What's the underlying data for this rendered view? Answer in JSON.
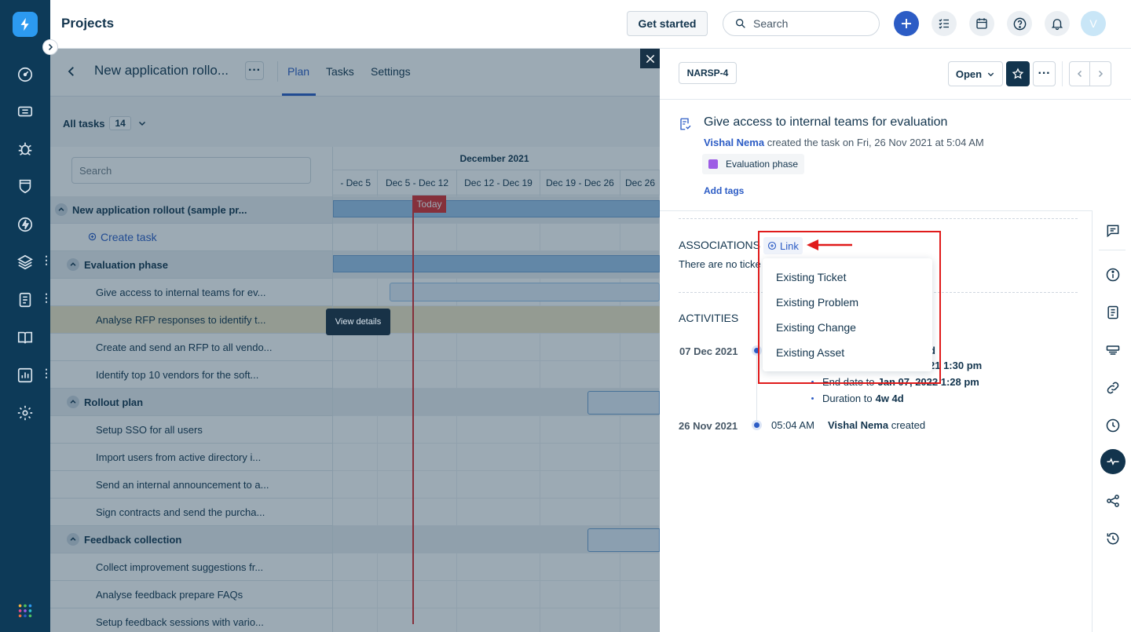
{
  "app": {
    "title": "Projects"
  },
  "header": {
    "get_started": "Get started",
    "search_placeholder": "Search",
    "avatar_initial": "V"
  },
  "project": {
    "name": "New application rollo...",
    "tabs": [
      "Plan",
      "Tasks",
      "Settings"
    ],
    "active_tab": "Plan",
    "all_tasks_label": "All tasks",
    "all_tasks_count": "14",
    "search_placeholder": "Search",
    "create_task": "Create task",
    "view_details": "View details",
    "rows": [
      {
        "text": "New application rollout (sample pr...",
        "kind": "root"
      },
      {
        "text": "Create task",
        "kind": "create"
      },
      {
        "text": "Evaluation phase",
        "kind": "group"
      },
      {
        "text": "Give access to internal teams for ev...",
        "kind": "task"
      },
      {
        "text": "Analyse RFP responses to identify t...",
        "kind": "task"
      },
      {
        "text": "Create and send an RFP to all vendo...",
        "kind": "task"
      },
      {
        "text": "Identify top 10 vendors for the soft...",
        "kind": "task"
      },
      {
        "text": "Rollout plan",
        "kind": "group"
      },
      {
        "text": "Setup SSO for all users",
        "kind": "task"
      },
      {
        "text": "Import users from active directory i...",
        "kind": "task"
      },
      {
        "text": "Send an internal announcement to a...",
        "kind": "task"
      },
      {
        "text": "Sign contracts and send the purcha...",
        "kind": "task"
      },
      {
        "text": "Feedback collection",
        "kind": "group"
      },
      {
        "text": "Collect improvement suggestions fr...",
        "kind": "task"
      },
      {
        "text": "Analyse feedback prepare FAQs",
        "kind": "task"
      },
      {
        "text": "Setup feedback sessions with vario...",
        "kind": "task"
      }
    ]
  },
  "gantt": {
    "month": "December 2021",
    "weeks": [
      "- Dec 5",
      "Dec 5 - Dec 12",
      "Dec 12 - Dec 19",
      "Dec 19 - Dec 26",
      "Dec 26"
    ],
    "today_label": "Today"
  },
  "task": {
    "id": "NARSP-4",
    "status": "Open",
    "title": "Give access to internal teams for evaluation",
    "creator": "Vishal Nema",
    "created_text": "created the task on Fri, 26 Nov 2021 at 5:04 AM",
    "phase_tag": "Evaluation phase",
    "add_tags": "Add tags"
  },
  "associations": {
    "heading": "ASSOCIATIONS",
    "link_label": "Link",
    "empty_text": "There are no ticke",
    "menu": [
      "Existing Ticket",
      "Existing Problem",
      "Existing Change",
      "Existing Asset"
    ]
  },
  "activities": {
    "heading": "ACTIVITIES",
    "entries": [
      {
        "date": "07 Dec 2021",
        "partial_top": "d",
        "partial_line": "21 1:30 pm",
        "bullets": [
          {
            "label": "End date to",
            "value": "Jan 07, 2022 1:28 pm"
          },
          {
            "label": "Duration to",
            "value": "4w 4d"
          }
        ]
      },
      {
        "date": "26 Nov 2021",
        "time": "05:04 AM",
        "actor": "Vishal Nema",
        "action": "created"
      }
    ]
  },
  "colors": {
    "rail": "#0d3a58",
    "accent": "#2c5cc5",
    "annotation": "#e01b1b",
    "today": "#d72d30"
  }
}
